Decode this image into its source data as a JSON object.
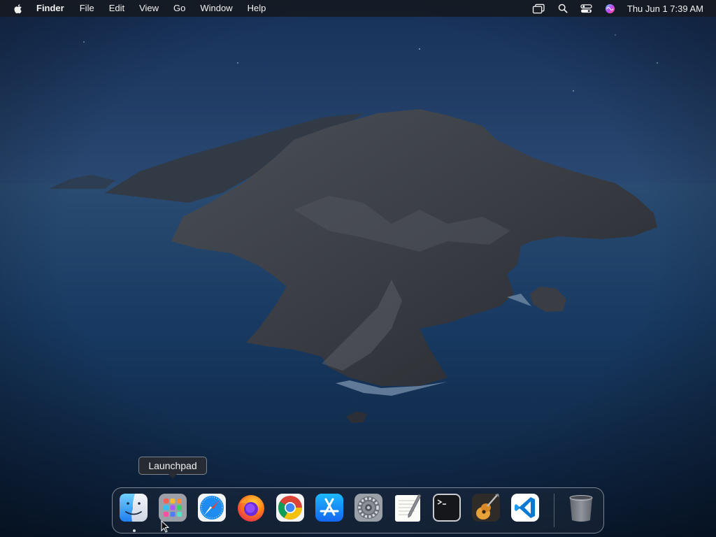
{
  "menubar": {
    "apple_icon": "apple-logo-icon",
    "app_name": "Finder",
    "menus": [
      "File",
      "Edit",
      "View",
      "Go",
      "Window",
      "Help"
    ],
    "status_icons": [
      "screen-mirroring-icon",
      "spotlight-search-icon",
      "control-center-icon",
      "siri-icon"
    ],
    "clock": "Thu Jun 1  7:39 AM"
  },
  "tooltip": {
    "label": "Launchpad"
  },
  "dock": {
    "apps": [
      {
        "name": "Finder",
        "icon": "finder-icon",
        "running": true
      },
      {
        "name": "Launchpad",
        "icon": "launchpad-icon",
        "running": false
      },
      {
        "name": "Safari",
        "icon": "safari-icon",
        "running": false
      },
      {
        "name": "Firefox",
        "icon": "firefox-icon",
        "running": false
      },
      {
        "name": "Google Chrome",
        "icon": "chrome-icon",
        "running": false
      },
      {
        "name": "App Store",
        "icon": "app-store-icon",
        "running": false
      },
      {
        "name": "System Preferences",
        "icon": "system-preferences-icon",
        "running": false
      },
      {
        "name": "TextEdit",
        "icon": "textedit-icon",
        "running": false
      },
      {
        "name": "Terminal",
        "icon": "terminal-icon",
        "running": false
      },
      {
        "name": "GarageBand",
        "icon": "garageband-icon",
        "running": false
      },
      {
        "name": "Visual Studio Code",
        "icon": "vscode-icon",
        "running": false
      }
    ],
    "trash": {
      "name": "Trash",
      "icon": "trash-icon"
    }
  },
  "colors": {
    "sky_top": "#163059",
    "sea": "#0f2a4a",
    "menubar_bg": "#161a22"
  }
}
